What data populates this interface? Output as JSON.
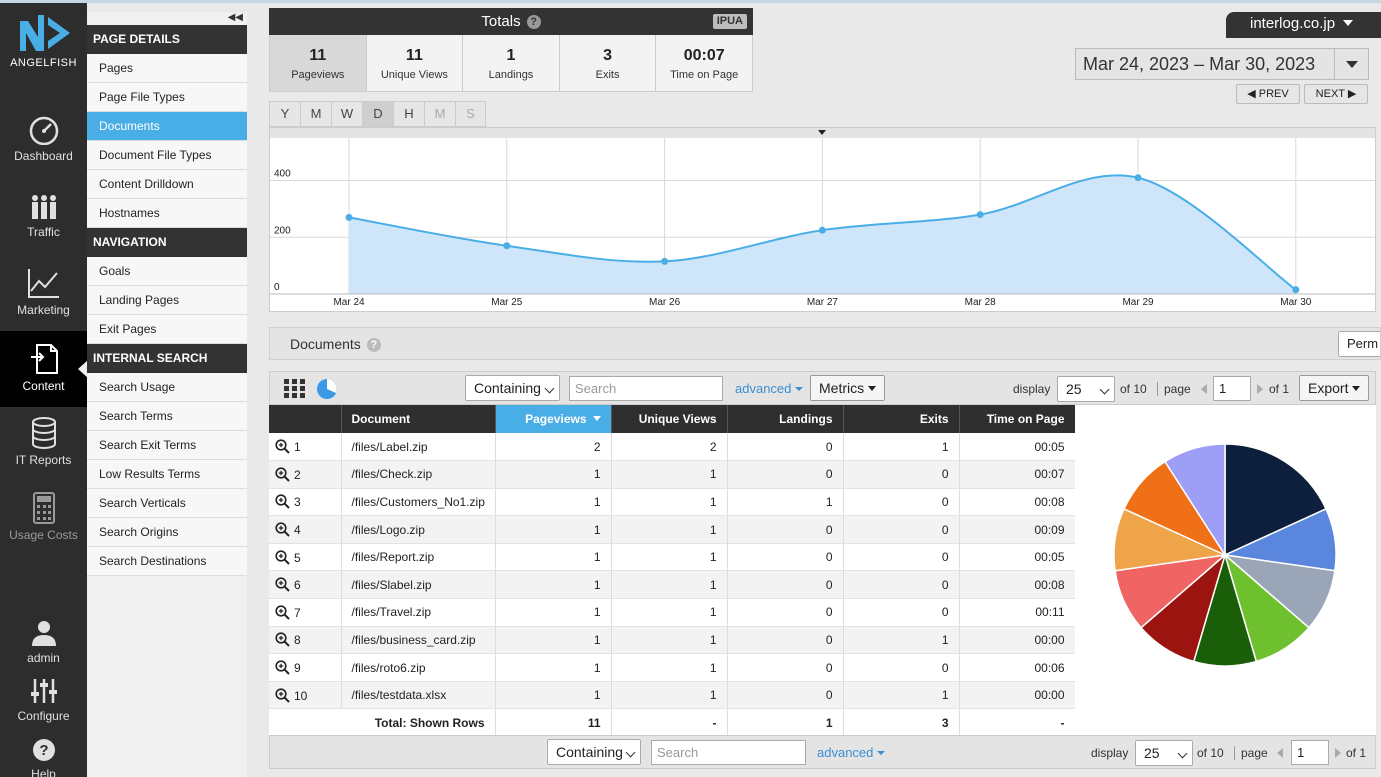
{
  "logo": {
    "text": "ANGELFISH"
  },
  "iconbar": [
    {
      "label": "Dashboard",
      "icon": "gauge-icon"
    },
    {
      "label": "Traffic",
      "icon": "people-icon"
    },
    {
      "label": "Marketing",
      "icon": "line-chart-icon"
    },
    {
      "label": "Content",
      "icon": "document-icon",
      "active": true
    },
    {
      "label": "IT Reports",
      "icon": "database-icon"
    },
    {
      "label": "Usage Costs",
      "icon": "calculator-icon",
      "dim": true
    },
    {
      "label": "admin",
      "icon": "user-icon"
    },
    {
      "label": "Configure",
      "icon": "sliders-icon"
    },
    {
      "label": "Help",
      "icon": "help-icon"
    }
  ],
  "submenu": {
    "collapse": "◀◀",
    "page_details": {
      "title": "PAGE DETAILS",
      "items": [
        "Pages",
        "Page File Types",
        "Documents",
        "Document File Types",
        "Content Drilldown",
        "Hostnames"
      ]
    },
    "navigation": {
      "title": "NAVIGATION",
      "items": [
        "Goals",
        "Landing Pages",
        "Exit Pages"
      ]
    },
    "internal_search": {
      "title": "INTERNAL SEARCH",
      "items": [
        "Search Usage",
        "Search Terms",
        "Search Exit Terms",
        "Low Results Terms",
        "Search Verticals",
        "Search Origins",
        "Search Destinations"
      ]
    }
  },
  "totals": {
    "title": "Totals",
    "help": "?",
    "badge": "IPUA",
    "cells": [
      {
        "value": "11",
        "label": "Pageviews"
      },
      {
        "value": "11",
        "label": "Unique Views"
      },
      {
        "value": "1",
        "label": "Landings"
      },
      {
        "value": "3",
        "label": "Exits"
      },
      {
        "value": "00:07",
        "label": "Time on Page"
      }
    ]
  },
  "host": "interlog.co.jp",
  "daterange": "Mar 24, 2023 – Mar 30, 2023",
  "prev_label": "PREV",
  "next_label": "NEXT",
  "granularity": [
    "Y",
    "M",
    "W",
    "D",
    "H",
    "M",
    "S"
  ],
  "chart_data": {
    "type": "area",
    "categories": [
      "Mar 24",
      "Mar 25",
      "Mar 26",
      "Mar 27",
      "Mar 28",
      "Mar 29",
      "Mar 30"
    ],
    "series": [
      {
        "values": [
          270,
          170,
          115,
          225,
          280,
          410,
          15
        ]
      }
    ],
    "y_ticks": [
      "0",
      "200",
      "400"
    ],
    "ylim": [
      0,
      550
    ],
    "color": "#4aaee6",
    "fill": "#cfe6fa",
    "grid": true
  },
  "documents": {
    "title": "Documents",
    "help": "?",
    "perm": "Perm"
  },
  "toolbar": {
    "filter_mode": "Containing",
    "search_placeholder": "Search",
    "advanced": "advanced",
    "metrics": "Metrics",
    "display_label": "display",
    "display_value": "25",
    "of_pages": "of 10",
    "page_label": "page",
    "page_value": "1",
    "of_total": "of 1",
    "export": "Export"
  },
  "table": {
    "headers": [
      "Document",
      "Pageviews",
      "Unique Views",
      "Landings",
      "Exits",
      "Time on Page"
    ],
    "rows": [
      {
        "n": "1",
        "doc": "/files/Label.zip",
        "pv": "2",
        "uv": "2",
        "land": "0",
        "exits": "1",
        "top": "00:05"
      },
      {
        "n": "2",
        "doc": "/files/Check.zip",
        "pv": "1",
        "uv": "1",
        "land": "0",
        "exits": "0",
        "top": "00:07"
      },
      {
        "n": "3",
        "doc": "/files/Customers_No1.zip",
        "pv": "1",
        "uv": "1",
        "land": "1",
        "exits": "0",
        "top": "00:08"
      },
      {
        "n": "4",
        "doc": "/files/Logo.zip",
        "pv": "1",
        "uv": "1",
        "land": "0",
        "exits": "0",
        "top": "00:09"
      },
      {
        "n": "5",
        "doc": "/files/Report.zip",
        "pv": "1",
        "uv": "1",
        "land": "0",
        "exits": "0",
        "top": "00:05"
      },
      {
        "n": "6",
        "doc": "/files/Slabel.zip",
        "pv": "1",
        "uv": "1",
        "land": "0",
        "exits": "0",
        "top": "00:08"
      },
      {
        "n": "7",
        "doc": "/files/Travel.zip",
        "pv": "1",
        "uv": "1",
        "land": "0",
        "exits": "0",
        "top": "00:11"
      },
      {
        "n": "8",
        "doc": "/files/business_card.zip",
        "pv": "1",
        "uv": "1",
        "land": "0",
        "exits": "1",
        "top": "00:00"
      },
      {
        "n": "9",
        "doc": "/files/roto6.zip",
        "pv": "1",
        "uv": "1",
        "land": "0",
        "exits": "0",
        "top": "00:06"
      },
      {
        "n": "10",
        "doc": "/files/testdata.xlsx",
        "pv": "1",
        "uv": "1",
        "land": "0",
        "exits": "1",
        "top": "00:00"
      }
    ],
    "total": {
      "label": "Total: Shown Rows",
      "pv": "11",
      "uv": "-",
      "land": "1",
      "exits": "3",
      "top": "-"
    }
  },
  "pie": {
    "values": [
      2,
      1,
      1,
      1,
      1,
      1,
      1,
      1,
      1,
      1
    ],
    "colors": [
      "#0d1f3c",
      "#5b86dd",
      "#9aa6b7",
      "#6fc02f",
      "#1b5e0a",
      "#9b1410",
      "#f06464",
      "#f0a44a",
      "#f07018",
      "#9e9ef7"
    ]
  }
}
